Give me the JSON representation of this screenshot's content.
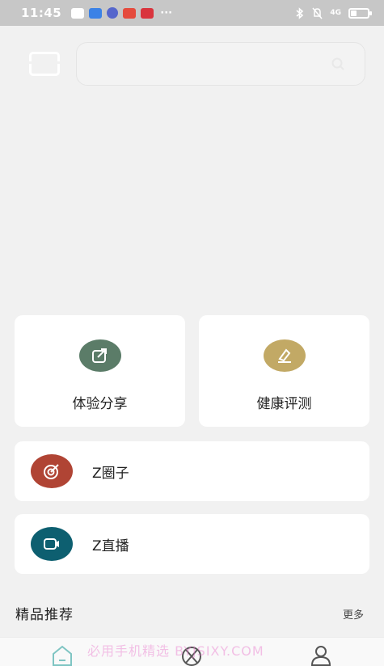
{
  "status_bar": {
    "time": "11:45",
    "more": "···",
    "signal": "4G"
  },
  "search": {
    "placeholder": ""
  },
  "features": {
    "share_label": "体验分享",
    "health_label": "健康评测",
    "circle_label": "Z圈子",
    "live_label": "Z直播"
  },
  "section": {
    "title": "精品推荐",
    "more": "更多"
  },
  "watermark": "必用手机精选 BYJSIXY.COM",
  "colors": {
    "share": "#5b7c68",
    "health": "#c2a965",
    "circle": "#b04434",
    "live": "#0d5f70",
    "tab_active": "#7fc5c3"
  }
}
